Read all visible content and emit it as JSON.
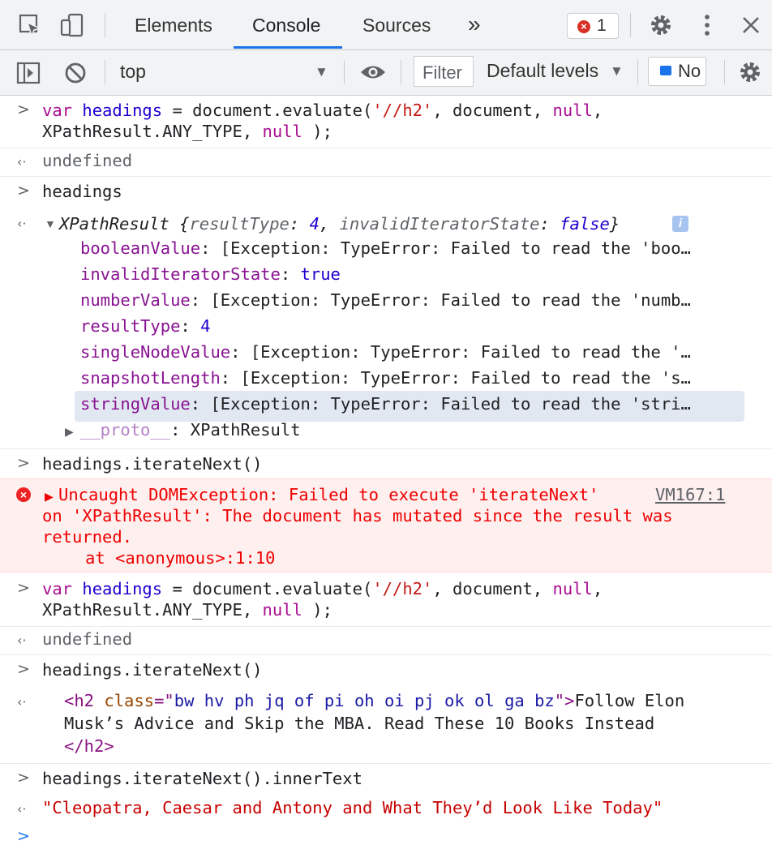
{
  "tabs": [
    {
      "label": "Elements"
    },
    {
      "label": "Console"
    },
    {
      "label": "Sources"
    }
  ],
  "more_tabs": "»",
  "error_count": "1",
  "toolbar": {
    "context": "top",
    "filter_placeholder": "Filter",
    "levels": "Default levels",
    "issues": "No"
  },
  "console": {
    "cmd1_line1": {
      "kw": "var",
      "ident": "headings",
      "mid": " = document.evaluate(",
      "str": "'//h2'",
      "mid2": ", document, ",
      "nul": "null",
      "end": ","
    },
    "cmd1_line2": {
      "pre": "XPathResult.ANY_TYPE, ",
      "nul": "null",
      "end": " );"
    },
    "out1": "undefined",
    "cmd2": "headings",
    "obj_summary": {
      "name": "XPathResult",
      "open": " {",
      "k1": "resultType",
      "v1": "4",
      "k2": "invalidIteratorState",
      "v2": "false",
      "close": "}"
    },
    "props": [
      {
        "key": "booleanValue",
        "val": "[Exception: TypeError: Failed to read the 'boo…"
      },
      {
        "key": "invalidIteratorState",
        "val": "true"
      },
      {
        "key": "numberValue",
        "val": "[Exception: TypeError: Failed to read the 'numb…"
      },
      {
        "key": "resultType",
        "val": "4"
      },
      {
        "key": "singleNodeValue",
        "val": "[Exception: TypeError: Failed to read the '…"
      },
      {
        "key": "snapshotLength",
        "val": "[Exception: TypeError: Failed to read the 's…"
      },
      {
        "key": "stringValue",
        "val": "[Exception: TypeError: Failed to read the 'stri…"
      }
    ],
    "proto_key": "__proto__",
    "proto_val": "XPathResult",
    "cmd3": "headings.iterateNext()",
    "error": {
      "line1": "Uncaught DOMException: Failed to execute 'iterateNext'",
      "link": "VM167:1",
      "line2": "on 'XPathResult': The document has mutated since the result was",
      "line3": "returned.",
      "line4": "at <anonymous>:1:10"
    },
    "cmd4_line1": {
      "kw": "var",
      "ident": "headings",
      "mid": " = document.evaluate(",
      "str": "'//h2'",
      "mid2": ", document, ",
      "nul": "null",
      "end": ","
    },
    "cmd4_line2": {
      "pre": "XPathResult.ANY_TYPE, ",
      "nul": "null",
      "end": " );"
    },
    "out4": "undefined",
    "cmd5": "headings.iterateNext()",
    "h2_out": {
      "open": "<h2",
      "attr": "class",
      "eq": "=\"",
      "val": "bw hv ph jq of pi oh oi pj ok ol ga bz",
      "q": "\">",
      "text1": "Follow Elon",
      "text2": "Musk’s Advice and Skip the MBA. Read These 10 Books Instead",
      "close": "</h2>"
    },
    "cmd6": "headings.iterateNext().innerText",
    "out6": "\"Cleopatra, Caesar and Antony and What They’d Look Like Today\""
  }
}
